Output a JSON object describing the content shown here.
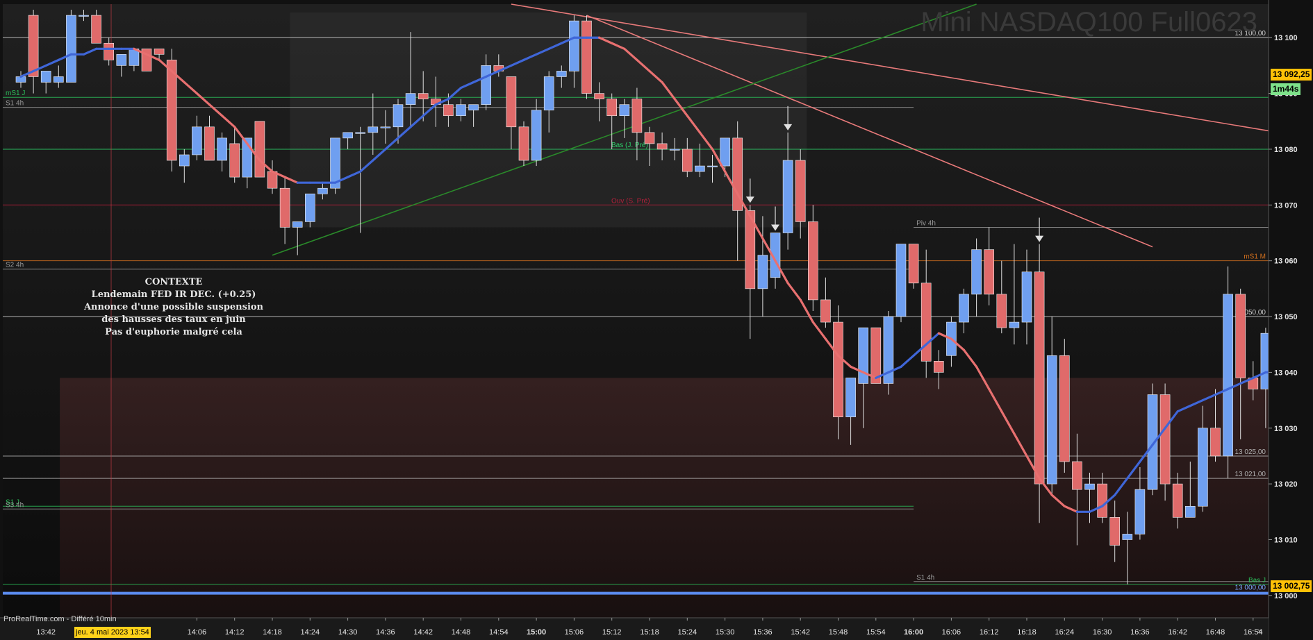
{
  "window": {
    "watermark": "Mini NASDAQ100 Full0623",
    "footer": "ProRealTime.com - Différé 10min",
    "cursor_date": "jeu. 4 mai 2023 13:54",
    "last_price": "13 092,25",
    "countdown": "1m44s",
    "low_price_tag": "13 002,75",
    "nav_arrow": "»"
  },
  "context": {
    "title": "CONTEXTE",
    "lines": [
      "Lendemain FED IR DEC. (+0.25)",
      "Annonce d'une possible suspension",
      "des hausses des taux en juin",
      "Pas d'euphorie malgré cela"
    ]
  },
  "colors": {
    "bull": "#6f9ff0",
    "bear": "#e06a6a",
    "ma_up": "#3f66d8",
    "ma_down": "#e87070",
    "s1j": "#2bbf5a",
    "ouv": "#b0203a",
    "orange": "#d2701e",
    "bg": "#101010"
  },
  "chart_data": {
    "type": "candlestick",
    "instrument": "Mini NASDAQ100 Full0623",
    "ylim": [
      12996,
      13106
    ],
    "yticks": [
      {
        "v": 13100,
        "label": "13 100"
      },
      {
        "v": 13090,
        "label": "13 090"
      },
      {
        "v": 13080,
        "label": "13 080"
      },
      {
        "v": 13070,
        "label": "13 070"
      },
      {
        "v": 13060,
        "label": "13 060"
      },
      {
        "v": 13050,
        "label": "13 050"
      },
      {
        "v": 13040,
        "label": "13 040"
      },
      {
        "v": 13030,
        "label": "13 030"
      },
      {
        "v": 13020,
        "label": "13 020"
      },
      {
        "v": 13010,
        "label": "13 010"
      },
      {
        "v": 13000,
        "label": "13 000"
      }
    ],
    "xticks": [
      {
        "i": 2,
        "label": "13:42"
      },
      {
        "i": 5,
        "label": "13:"
      },
      {
        "i": 14,
        "label": "14:06"
      },
      {
        "i": 17,
        "label": "14:12"
      },
      {
        "i": 20,
        "label": "14:18"
      },
      {
        "i": 23,
        "label": "14:24"
      },
      {
        "i": 26,
        "label": "14:30"
      },
      {
        "i": 29,
        "label": "14:36"
      },
      {
        "i": 32,
        "label": "14:42"
      },
      {
        "i": 35,
        "label": "14:48"
      },
      {
        "i": 38,
        "label": "14:54"
      },
      {
        "i": 41,
        "label": "15:00"
      },
      {
        "i": 44,
        "label": "15:06"
      },
      {
        "i": 47,
        "label": "15:12"
      },
      {
        "i": 50,
        "label": "15:18"
      },
      {
        "i": 53,
        "label": "15:24"
      },
      {
        "i": 56,
        "label": "15:30"
      },
      {
        "i": 59,
        "label": "15:36"
      },
      {
        "i": 62,
        "label": "15:42"
      },
      {
        "i": 65,
        "label": "15:48"
      },
      {
        "i": 68,
        "label": "15:54"
      },
      {
        "i": 71,
        "label": "16:00"
      },
      {
        "i": 74,
        "label": "16:06"
      },
      {
        "i": 77,
        "label": "16:12"
      },
      {
        "i": 80,
        "label": "16:18"
      },
      {
        "i": 83,
        "label": "16:24"
      },
      {
        "i": 86,
        "label": "16:30"
      },
      {
        "i": 89,
        "label": "16:36"
      },
      {
        "i": 92,
        "label": "16:42"
      },
      {
        "i": 95,
        "label": "16:48"
      },
      {
        "i": 98,
        "label": "16:54"
      }
    ],
    "candles": [
      {
        "o": 13092,
        "h": 13094,
        "l": 13091,
        "c": 13093
      },
      {
        "o": 13104,
        "h": 13105,
        "l": 13090,
        "c": 13093
      },
      {
        "o": 13092,
        "h": 13093,
        "l": 13090,
        "c": 13094
      },
      {
        "o": 13092,
        "h": 13095,
        "l": 13091,
        "c": 13093
      },
      {
        "o": 13092,
        "h": 13105,
        "l": 13092,
        "c": 13104
      },
      {
        "o": 13104,
        "h": 13105,
        "l": 13103,
        "c": 13104
      },
      {
        "o": 13104,
        "h": 13105,
        "l": 13099,
        "c": 13099
      },
      {
        "o": 13099,
        "h": 13100,
        "l": 13095,
        "c": 13096
      },
      {
        "o": 13095,
        "h": 13097,
        "l": 13093,
        "c": 13097
      },
      {
        "o": 13095,
        "h": 13098,
        "l": 13094,
        "c": 13098
      },
      {
        "o": 13098,
        "h": 13098,
        "l": 13094,
        "c": 13094
      },
      {
        "o": 13098,
        "h": 13098,
        "l": 13096,
        "c": 13097
      },
      {
        "o": 13096,
        "h": 13098,
        "l": 13076,
        "c": 13078
      },
      {
        "o": 13077,
        "h": 13080,
        "l": 13074,
        "c": 13079
      },
      {
        "o": 13079,
        "h": 13086,
        "l": 13078,
        "c": 13084
      },
      {
        "o": 13084,
        "h": 13086,
        "l": 13078,
        "c": 13078
      },
      {
        "o": 13078,
        "h": 13083,
        "l": 13076,
        "c": 13082
      },
      {
        "o": 13081,
        "h": 13084,
        "l": 13074,
        "c": 13075
      },
      {
        "o": 13075,
        "h": 13082,
        "l": 13073,
        "c": 13082
      },
      {
        "o": 13085,
        "h": 13085,
        "l": 13075,
        "c": 13075
      },
      {
        "o": 13076,
        "h": 13078,
        "l": 13072,
        "c": 13073
      },
      {
        "o": 13073,
        "h": 13075,
        "l": 13063,
        "c": 13066
      },
      {
        "o": 13066,
        "h": 13067,
        "l": 13061,
        "c": 13067
      },
      {
        "o": 13067,
        "h": 13071,
        "l": 13066,
        "c": 13072
      },
      {
        "o": 13072,
        "h": 13074,
        "l": 13071,
        "c": 13073
      },
      {
        "o": 13073,
        "h": 13081,
        "l": 13072,
        "c": 13082
      },
      {
        "o": 13082,
        "h": 13083,
        "l": 13080,
        "c": 13083
      },
      {
        "o": 13083,
        "h": 13084,
        "l": 13065,
        "c": 13083
      },
      {
        "o": 13083,
        "h": 13090,
        "l": 13079,
        "c": 13084
      },
      {
        "o": 13084,
        "h": 13087,
        "l": 13081,
        "c": 13084
      },
      {
        "o": 13084,
        "h": 13089,
        "l": 13081,
        "c": 13088
      },
      {
        "o": 13088,
        "h": 13101,
        "l": 13084,
        "c": 13090
      },
      {
        "o": 13090,
        "h": 13094,
        "l": 13085,
        "c": 13089
      },
      {
        "o": 13089,
        "h": 13093,
        "l": 13084,
        "c": 13088
      },
      {
        "o": 13088,
        "h": 13090,
        "l": 13084,
        "c": 13086
      },
      {
        "o": 13086,
        "h": 13089,
        "l": 13085,
        "c": 13088
      },
      {
        "o": 13087,
        "h": 13088,
        "l": 13084,
        "c": 13088
      },
      {
        "o": 13088,
        "h": 13097,
        "l": 13087,
        "c": 13095
      },
      {
        "o": 13095,
        "h": 13097,
        "l": 13093,
        "c": 13094
      },
      {
        "o": 13093,
        "h": 13093,
        "l": 13080,
        "c": 13084
      },
      {
        "o": 13084,
        "h": 13085,
        "l": 13077,
        "c": 13078
      },
      {
        "o": 13078,
        "h": 13089,
        "l": 13077,
        "c": 13087
      },
      {
        "o": 13087,
        "h": 13094,
        "l": 13083,
        "c": 13093
      },
      {
        "o": 13093,
        "h": 13095,
        "l": 13091,
        "c": 13094
      },
      {
        "o": 13094,
        "h": 13104,
        "l": 13091,
        "c": 13103
      },
      {
        "o": 13103,
        "h": 13104,
        "l": 13089,
        "c": 13090
      },
      {
        "o": 13090,
        "h": 13092,
        "l": 13085,
        "c": 13089
      },
      {
        "o": 13089,
        "h": 13090,
        "l": 13080,
        "c": 13086
      },
      {
        "o": 13086,
        "h": 13089,
        "l": 13082,
        "c": 13088
      },
      {
        "o": 13089,
        "h": 13091,
        "l": 13078,
        "c": 13083
      },
      {
        "o": 13083,
        "h": 13084,
        "l": 13077,
        "c": 13081
      },
      {
        "o": 13081,
        "h": 13083,
        "l": 13078,
        "c": 13080
      },
      {
        "o": 13080,
        "h": 13082,
        "l": 13078,
        "c": 13080
      },
      {
        "o": 13080,
        "h": 13082,
        "l": 13075,
        "c": 13076
      },
      {
        "o": 13076,
        "h": 13081,
        "l": 13075,
        "c": 13077
      },
      {
        "o": 13077,
        "h": 13079,
        "l": 13074,
        "c": 13077
      },
      {
        "o": 13077,
        "h": 13081,
        "l": 13075,
        "c": 13082
      },
      {
        "o": 13082,
        "h": 13085,
        "l": 13060,
        "c": 13069
      },
      {
        "o": 13069,
        "h": 13070,
        "l": 13046,
        "c": 13055
      },
      {
        "o": 13055,
        "h": 13068,
        "l": 13050,
        "c": 13061
      },
      {
        "o": 13057,
        "h": 13065,
        "l": 13055,
        "c": 13065
      },
      {
        "o": 13065,
        "h": 13083,
        "l": 13062,
        "c": 13078
      },
      {
        "o": 13078,
        "h": 13080,
        "l": 13064,
        "c": 13067
      },
      {
        "o": 13067,
        "h": 13070,
        "l": 13051,
        "c": 13053
      },
      {
        "o": 13053,
        "h": 13057,
        "l": 13048,
        "c": 13049
      },
      {
        "o": 13049,
        "h": 13052,
        "l": 13028,
        "c": 13032
      },
      {
        "o": 13032,
        "h": 13036,
        "l": 13027,
        "c": 13039
      },
      {
        "o": 13038,
        "h": 13048,
        "l": 13030,
        "c": 13048
      },
      {
        "o": 13048,
        "h": 13048,
        "l": 13038,
        "c": 13038
      },
      {
        "o": 13038,
        "h": 13051,
        "l": 13036,
        "c": 13050
      },
      {
        "o": 13050,
        "h": 13063,
        "l": 13049,
        "c": 13063
      },
      {
        "o": 13063,
        "h": 13063,
        "l": 13055,
        "c": 13056
      },
      {
        "o": 13056,
        "h": 13062,
        "l": 13039,
        "c": 13042
      },
      {
        "o": 13042,
        "h": 13044,
        "l": 13037,
        "c": 13040
      },
      {
        "o": 13043,
        "h": 13050,
        "l": 13041,
        "c": 13049
      },
      {
        "o": 13049,
        "h": 13055,
        "l": 13047,
        "c": 13054
      },
      {
        "o": 13054,
        "h": 13064,
        "l": 13050,
        "c": 13062
      },
      {
        "o": 13062,
        "h": 13066,
        "l": 13052,
        "c": 13054
      },
      {
        "o": 13054,
        "h": 13060,
        "l": 13047,
        "c": 13048
      },
      {
        "o": 13048,
        "h": 13063,
        "l": 13045,
        "c": 13049
      },
      {
        "o": 13049,
        "h": 13062,
        "l": 13045,
        "c": 13058
      },
      {
        "o": 13058,
        "h": 13063,
        "l": 13013,
        "c": 13020
      },
      {
        "o": 13020,
        "h": 13050,
        "l": 13018,
        "c": 13043
      },
      {
        "o": 13043,
        "h": 13046,
        "l": 13022,
        "c": 13024
      },
      {
        "o": 13024,
        "h": 13029,
        "l": 13009,
        "c": 13019
      },
      {
        "o": 13019,
        "h": 13022,
        "l": 13013,
        "c": 13020
      },
      {
        "o": 13020,
        "h": 13022,
        "l": 13013,
        "c": 13014
      },
      {
        "o": 13014,
        "h": 13017,
        "l": 13006,
        "c": 13009
      },
      {
        "o": 13010,
        "h": 13015,
        "l": 13002,
        "c": 13011
      },
      {
        "o": 13011,
        "h": 13023,
        "l": 13010,
        "c": 13019
      },
      {
        "o": 13019,
        "h": 13038,
        "l": 13018,
        "c": 13036
      },
      {
        "o": 13036,
        "h": 13038,
        "l": 13017,
        "c": 13020
      },
      {
        "o": 13020,
        "h": 13022,
        "l": 13012,
        "c": 13014
      },
      {
        "o": 13014,
        "h": 13024,
        "l": 13014,
        "c": 13016
      },
      {
        "o": 13016,
        "h": 13034,
        "l": 13015,
        "c": 13030
      },
      {
        "o": 13030,
        "h": 13037,
        "l": 13024,
        "c": 13025
      },
      {
        "o": 13025,
        "h": 13059,
        "l": 13021,
        "c": 13054
      },
      {
        "o": 13054,
        "h": 13055,
        "l": 13028,
        "c": 13039
      },
      {
        "o": 13039,
        "h": 13042,
        "l": 13035,
        "c": 13037
      },
      {
        "o": 13037,
        "h": 13048,
        "l": 13030,
        "c": 13047
      },
      {
        "o": 13047,
        "h": 13057,
        "l": 13043,
        "c": 13053
      },
      {
        "o": 13054,
        "h": 13055,
        "l": 13042,
        "c": 13045
      }
    ],
    "moving_average": [
      13093,
      13094,
      13095,
      13096,
      13097,
      13097,
      13098,
      13098,
      13098,
      13098,
      13097,
      13096,
      13094,
      13092,
      13090,
      13088,
      13086,
      13084,
      13081,
      13078,
      13076,
      13075,
      13074,
      13074,
      13074,
      13074,
      13075,
      13076,
      13078,
      13080,
      13082,
      13084,
      13086,
      13088,
      13089,
      13091,
      13092,
      13093,
      13094,
      13095,
      13096,
      13097,
      13098,
      13099,
      13100,
      13100,
      13100,
      13099,
      13098,
      13096,
      13094,
      13092,
      13089,
      13086,
      13083,
      13080,
      13076,
      13072,
      13068,
      13064,
      13060,
      13056,
      13053,
      13049,
      13046,
      13043,
      13041,
      13040,
      13039,
      13040,
      13041,
      13043,
      13045,
      13047,
      13046,
      13044,
      13041,
      13037,
      13033,
      13029,
      13025,
      13021,
      13018,
      13016,
      13015,
      13015,
      13016,
      13018,
      13021,
      13024,
      13027,
      13030,
      13033,
      13034,
      13035,
      13036,
      13037,
      13038,
      13039,
      13040,
      13040,
      13040,
      13041
    ],
    "levels": [
      {
        "name": "mS1 J",
        "v": 13089.3,
        "color": "#2bbf5a",
        "label": "mS1 J",
        "side": "left"
      },
      {
        "name": "S1 4h",
        "v": 13087.5,
        "color": "#9a9a9a",
        "label": "S1 4h",
        "side": "left",
        "end": 71
      },
      {
        "name": "Bas (J. Pré)",
        "v": 13080,
        "color": "#2bd36a",
        "label": "Bas (J. Pré)",
        "side": "mid"
      },
      {
        "name": "Ouv (S. Pré)",
        "v": 13070,
        "color": "#b0203a",
        "label": "Ouv (S. Pré)",
        "side": "mid"
      },
      {
        "name": "Piv 4h",
        "v": 13066,
        "color": "#9a9a9a",
        "label": "Piv 4h",
        "side": "right",
        "start": 71
      },
      {
        "name": "mS1 M",
        "v": 13060,
        "color": "#d2701e",
        "label": "mS1 M",
        "side": "right"
      },
      {
        "name": "S2 4h",
        "v": 13058.5,
        "color": "#9a9a9a",
        "label": "S2 4h",
        "side": "left",
        "end": 71
      },
      {
        "name": "level 13 050",
        "v": 13050,
        "color": "#cfcfcf",
        "label": "13 050,00",
        "side": "right"
      },
      {
        "name": "level 13 025",
        "v": 13025,
        "color": "#b0b0b0",
        "label": "13 025,00",
        "side": "right"
      },
      {
        "name": "level 13 021",
        "v": 13021,
        "color": "#b0b0b0",
        "label": "13 021,00",
        "side": "right"
      },
      {
        "name": "S1 J",
        "v": 13016,
        "color": "#2bbf5a",
        "label": "S1 J",
        "side": "left",
        "end": 71
      },
      {
        "name": "S3 4h",
        "v": 13015.5,
        "color": "#9a9a9a",
        "label": "S3 4h",
        "side": "left",
        "end": 71
      },
      {
        "name": "S1 4h low",
        "v": 13002.5,
        "color": "#9a9a9a",
        "label": "S1 4h",
        "side": "right",
        "start": 71
      },
      {
        "name": "Bas J",
        "v": 13002,
        "color": "#2bbf5a",
        "label": "Bas J",
        "side": "right"
      },
      {
        "name": "level 13 100",
        "v": 13100,
        "color": "#cfcfcf",
        "label": "13 100,00",
        "side": "right"
      }
    ],
    "trendlines": [
      {
        "name": "trendline-main-down",
        "from": [
          39,
          13106
        ],
        "to": [
          100,
          13083
        ],
        "color": "#e87a7a"
      },
      {
        "name": "trendline-steep-down",
        "from": [
          45,
          13104
        ],
        "to": [
          90,
          13062.5
        ],
        "color": "#e87a7a"
      },
      {
        "name": "trendline-up",
        "from": [
          20,
          13061
        ],
        "to": [
          76,
          13106
        ],
        "color": "#2a8a2a"
      }
    ],
    "arrows": [
      58,
      60,
      61,
      81
    ]
  }
}
